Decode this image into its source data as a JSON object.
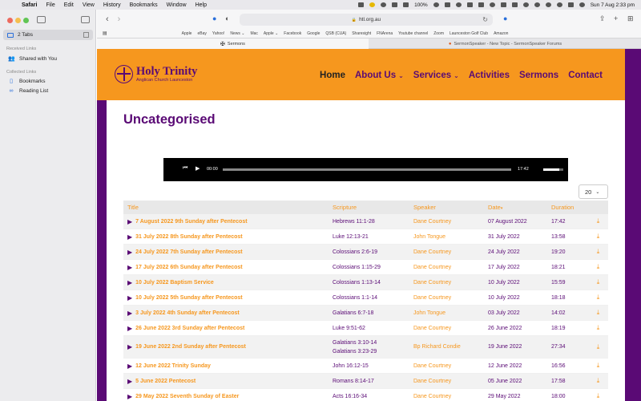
{
  "menubar": {
    "items": [
      "Safari",
      "File",
      "Edit",
      "View",
      "History",
      "Bookmarks",
      "Window",
      "Help"
    ],
    "battery": "100%",
    "datetime": "Sun 7 Aug  2:33 pm"
  },
  "sidebar": {
    "tabs_label": "2 Tabs",
    "received_heading": "Received Links",
    "shared_with_you": "Shared with You",
    "collected_heading": "Collected Links",
    "bookmarks": "Bookmarks",
    "reading_list": "Reading List"
  },
  "toolbar": {
    "url": "htl.org.au"
  },
  "bookmarks_bar": [
    "Apple",
    "eBay",
    "Yahoo!",
    "News ⌄",
    "Mac",
    "Apple ⌄",
    "Facebook",
    "Google",
    "QSB (CUA)",
    "Sharesight",
    "FNArena",
    "Youtube channel",
    "Zoom",
    "Launceston Golf Club",
    "Amazon"
  ],
  "tabs": [
    "Sermons",
    "SermonSpeaker - New Topic - SermonSpeaker Forums"
  ],
  "site": {
    "logo_name": "Holy Trinity",
    "logo_sub": "Anglican Church Launceston",
    "nav": [
      {
        "label": "Home",
        "dropdown": false
      },
      {
        "label": "About Us",
        "dropdown": true
      },
      {
        "label": "Services",
        "dropdown": true
      },
      {
        "label": "Activities",
        "dropdown": false
      },
      {
        "label": "Sermons",
        "dropdown": false
      },
      {
        "label": "Contact",
        "dropdown": false
      }
    ],
    "page_title": "Uncategorised",
    "player": {
      "current": "00:00",
      "duration": "17:42"
    },
    "per_page": "20"
  },
  "table": {
    "headers": [
      "Title",
      "Scripture",
      "Speaker",
      "Date",
      "Duration"
    ],
    "rows": [
      {
        "title": "7 August 2022 9th Sunday after Pentecost",
        "scripture": [
          "Hebrews 11:1-28"
        ],
        "speaker": "Dane Courtney",
        "date": "07 August 2022",
        "duration": "17:42"
      },
      {
        "title": "31 July 2022 8th Sunday after Pentecost",
        "scripture": [
          "Luke 12:13-21"
        ],
        "speaker": "John Tongue",
        "date": "31 July 2022",
        "duration": "13:58"
      },
      {
        "title": "24 July 2022 7th Sunday after Pentecost",
        "scripture": [
          "Colossians 2:6-19"
        ],
        "speaker": "Dane Courtney",
        "date": "24 July 2022",
        "duration": "19:20"
      },
      {
        "title": "17 July 2022 6th Sunday after Pentecost",
        "scripture": [
          "Colossians 1:15-29"
        ],
        "speaker": "Dane Courtney",
        "date": "17 July 2022",
        "duration": "18:21"
      },
      {
        "title": "10 July 2022 Baptism Service",
        "scripture": [
          "Colossians 1:13-14"
        ],
        "speaker": "Dane Courtney",
        "date": "10 July 2022",
        "duration": "15:59"
      },
      {
        "title": "10 July 2022 5th Sunday after Pentecost",
        "scripture": [
          "Colossians 1:1-14"
        ],
        "speaker": "Dane Courtney",
        "date": "10 July 2022",
        "duration": "18:18"
      },
      {
        "title": "3 July 2022 4th Sunday after Pentecost",
        "scripture": [
          "Galatians 6:7-18"
        ],
        "speaker": "John Tongue",
        "date": "03 July 2022",
        "duration": "14:02"
      },
      {
        "title": "26 June 2022 3rd Sunday after Pentecost",
        "scripture": [
          "Luke 9:51-62"
        ],
        "speaker": "Dane Courtney",
        "date": "26 June 2022",
        "duration": "18:19"
      },
      {
        "title": "19 June 2022 2nd Sunday after Pentecost",
        "scripture": [
          "Galatians 3:10-14",
          "Galatians 3:23-29"
        ],
        "speaker": "Bp Richard Condie",
        "date": "19 June 2022",
        "duration": "27:34"
      },
      {
        "title": "12 June 2022 Trinity Sunday",
        "scripture": [
          "John 16:12-15"
        ],
        "speaker": "Dane Courtney",
        "date": "12 June 2022",
        "duration": "16:56"
      },
      {
        "title": "5 June 2022 Pentecost",
        "scripture": [
          "Romans 8:14-17"
        ],
        "speaker": "Dane Courtney",
        "date": "05 June 2022",
        "duration": "17:58"
      },
      {
        "title": "29 May 2022 Seventh Sunday of Easter",
        "scripture": [
          "Acts 16:16-34"
        ],
        "speaker": "Dane Courtney",
        "date": "29 May 2022",
        "duration": "18:00"
      }
    ]
  },
  "colors": {
    "purple": "#5a0a75",
    "orange": "#f6971e"
  }
}
